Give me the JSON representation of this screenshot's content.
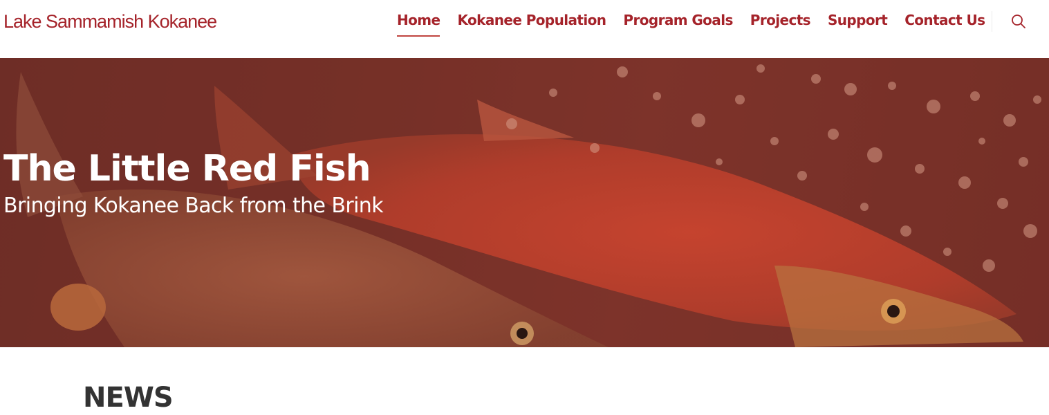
{
  "site": {
    "title": "Lake Sammamish Kokanee",
    "brand_color": "#a5232a"
  },
  "nav": {
    "items": [
      {
        "label": "Home",
        "active": true
      },
      {
        "label": "Kokanee Population",
        "active": false
      },
      {
        "label": "Program Goals",
        "active": false
      },
      {
        "label": "Projects",
        "active": false
      },
      {
        "label": "Support",
        "active": false
      },
      {
        "label": "Contact Us",
        "active": false
      }
    ],
    "search_icon": "search-icon"
  },
  "hero": {
    "title": "The Little Red Fish",
    "subtitle": "Bringing Kokanee Back from the Brink",
    "overlay_color": "#7b3329"
  },
  "news": {
    "heading": "NEWS"
  }
}
